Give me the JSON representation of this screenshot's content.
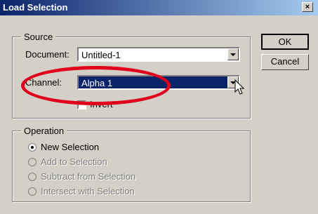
{
  "window": {
    "title": "Load Selection",
    "close_label": "×"
  },
  "source": {
    "legend": "Source",
    "document_label": "Document:",
    "document_value": "Untitled-1",
    "channel_label": "Channel:",
    "channel_value": "Alpha 1",
    "invert_label": "Invert",
    "invert_checked": false
  },
  "operation": {
    "legend": "Operation",
    "options": [
      {
        "label": "New Selection",
        "selected": true,
        "enabled": true
      },
      {
        "label": "Add to Selection",
        "selected": false,
        "enabled": false
      },
      {
        "label": "Subtract from Selection",
        "selected": false,
        "enabled": false
      },
      {
        "label": "Intersect with Selection",
        "selected": false,
        "enabled": false
      }
    ]
  },
  "buttons": {
    "ok": "OK",
    "cancel": "Cancel"
  },
  "annotation": {
    "color": "#e0001b"
  }
}
